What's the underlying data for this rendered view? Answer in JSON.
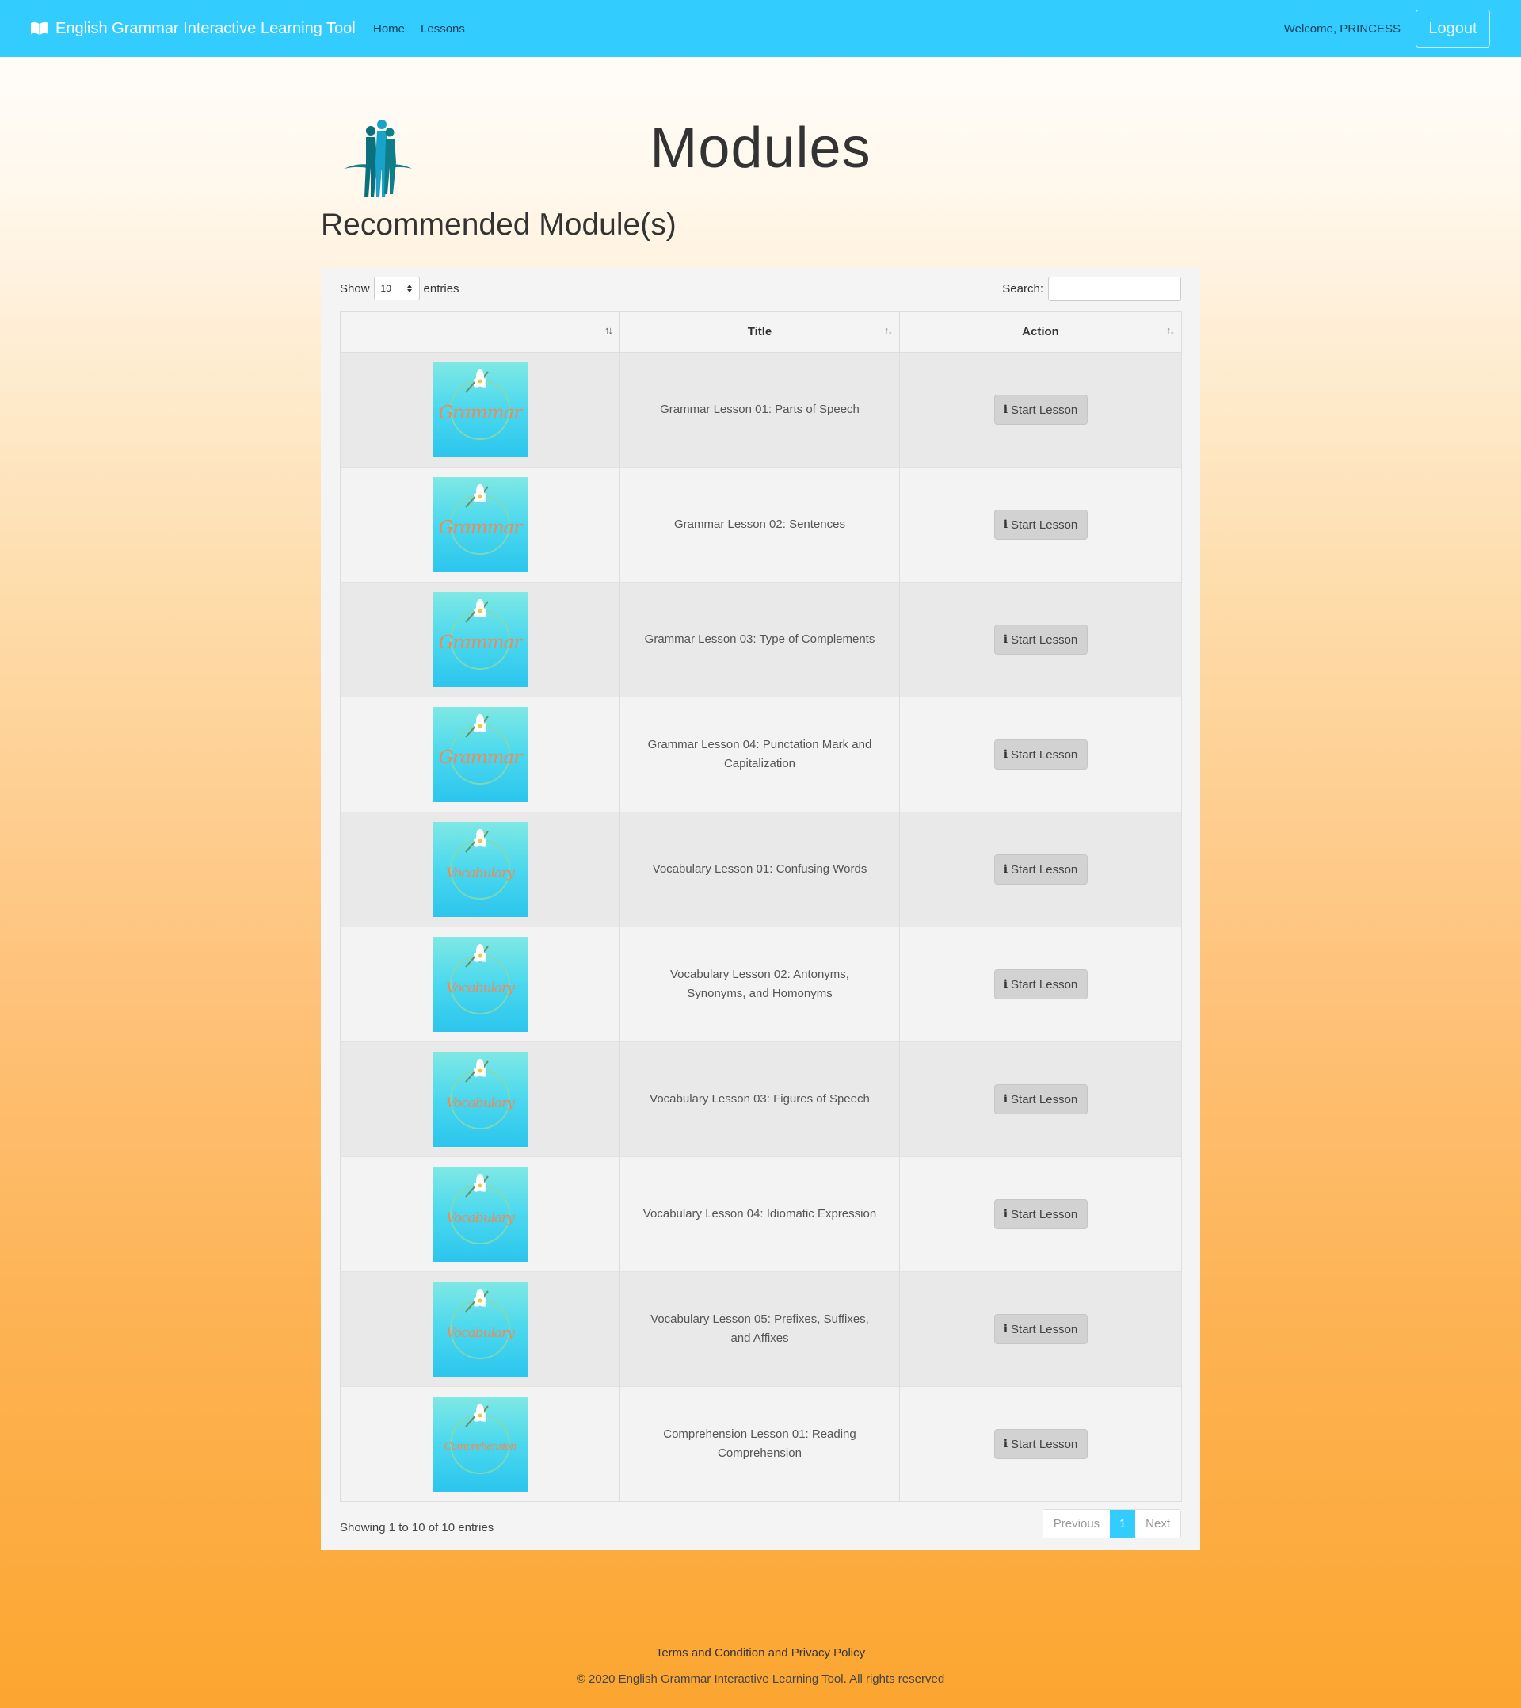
{
  "nav": {
    "brand": "English Grammar Interactive Learning Tool",
    "brand_icon": "open-book-icon",
    "links": [
      "Home",
      "Lessons"
    ],
    "welcome": "Welcome, PRINCESS",
    "logout": "Logout",
    "accent_color": "#33ccff"
  },
  "header": {
    "title": "Modules",
    "section_title": "Recommended Module(s)"
  },
  "table_controls": {
    "show_label": "Show",
    "length_value": "10",
    "entries_label": "entries",
    "search_label": "Search:",
    "search_value": ""
  },
  "table": {
    "columns": [
      "",
      "Title",
      "Action"
    ],
    "rows": [
      {
        "thumb": "Grammar",
        "title": "Grammar Lesson 01: Parts of Speech",
        "action": "Start Lesson"
      },
      {
        "thumb": "Grammar",
        "title": "Grammar Lesson 02: Sentences",
        "action": "Start Lesson"
      },
      {
        "thumb": "Grammar",
        "title": "Grammar Lesson 03: Type of Complements",
        "action": "Start Lesson"
      },
      {
        "thumb": "Grammar",
        "title": "Grammar Lesson 04: Punctation Mark and Capitalization",
        "action": "Start Lesson"
      },
      {
        "thumb": "Vocabulary",
        "title": "Vocabulary Lesson 01: Confusing Words",
        "action": "Start Lesson"
      },
      {
        "thumb": "Vocabulary",
        "title": "Vocabulary Lesson 02: Antonyms, Synonyms, and Homonyms",
        "action": "Start Lesson"
      },
      {
        "thumb": "Vocabulary",
        "title": "Vocabulary Lesson 03: Figures of Speech",
        "action": "Start Lesson"
      },
      {
        "thumb": "Vocabulary",
        "title": "Vocabulary Lesson 04: Idiomatic Expression",
        "action": "Start Lesson"
      },
      {
        "thumb": "Vocabulary",
        "title": "Vocabulary Lesson 05: Prefixes, Suffixes, and Affixes",
        "action": "Start Lesson"
      },
      {
        "thumb": "Comprehension",
        "title": "Comprehension Lesson 01: Reading Comprehension",
        "action": "Start Lesson"
      }
    ]
  },
  "table_footer": {
    "info": "Showing 1 to 10 of 10 entries",
    "previous": "Previous",
    "current_page": "1",
    "next": "Next"
  },
  "footer": {
    "links": "Terms and Condition and Privacy Policy",
    "copyright": "© 2020 English Grammar Interactive Learning Tool. All rights reserved"
  }
}
